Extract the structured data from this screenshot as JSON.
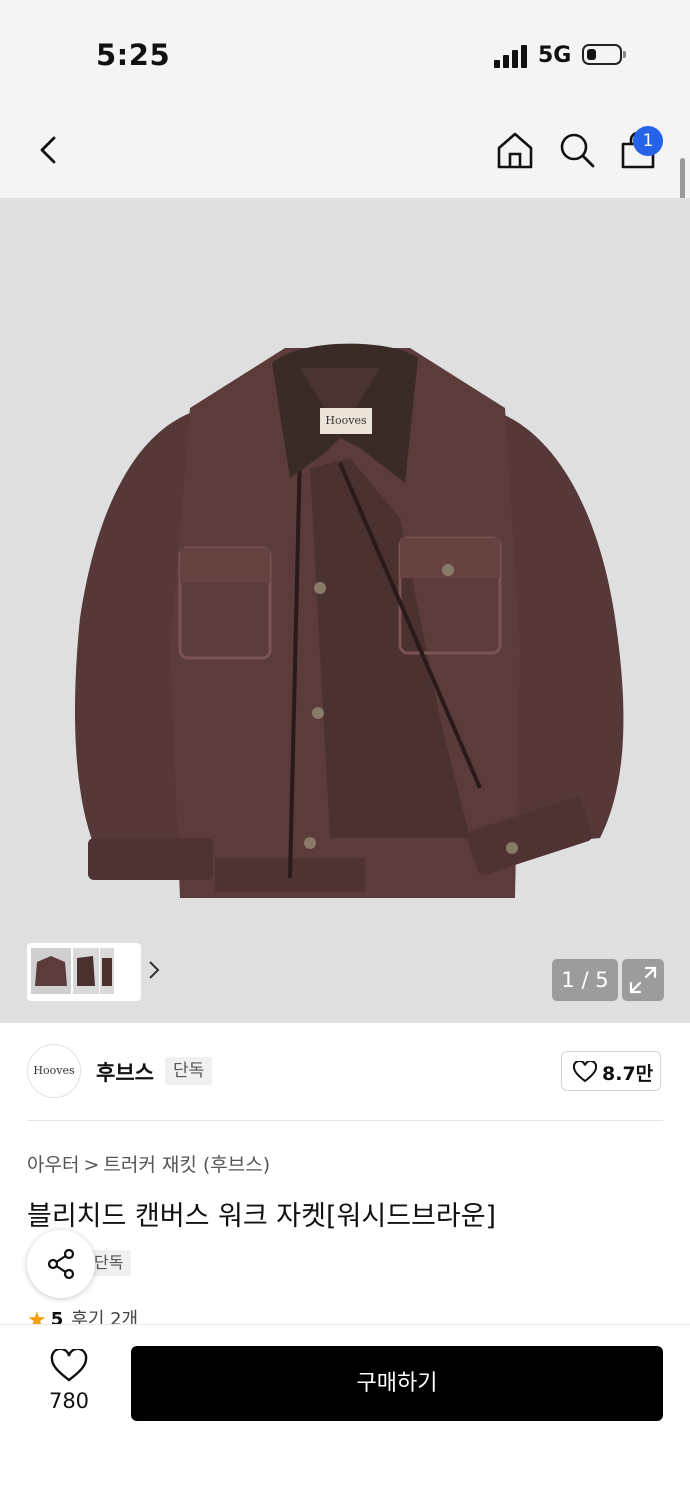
{
  "status_bar": {
    "time": "5:25",
    "network": "5G"
  },
  "nav": {
    "cart_badge": "1"
  },
  "gallery": {
    "page_indicator": "1 / 5"
  },
  "brand": {
    "logo_text": "Hooves",
    "name": "후브스",
    "tag": "단독",
    "likes": "8.7만"
  },
  "breadcrumb": {
    "category": "아우터",
    "separator": ">",
    "subcategory": "트러커 재킷 (후브스)"
  },
  "product": {
    "title": "블리치드 캔버스 워크 자켓[워시드브라운]",
    "tag": "단독",
    "rating_score": "5",
    "review_label": "후기 2개",
    "label_text": "Hooves"
  },
  "bottom_bar": {
    "wishlist_count": "780",
    "buy_label": "구매하기"
  },
  "colors": {
    "accent_blue": "#2563eb",
    "star": "#f59e0b",
    "buy_button": "#000000",
    "jacket": "#5a3b39"
  }
}
